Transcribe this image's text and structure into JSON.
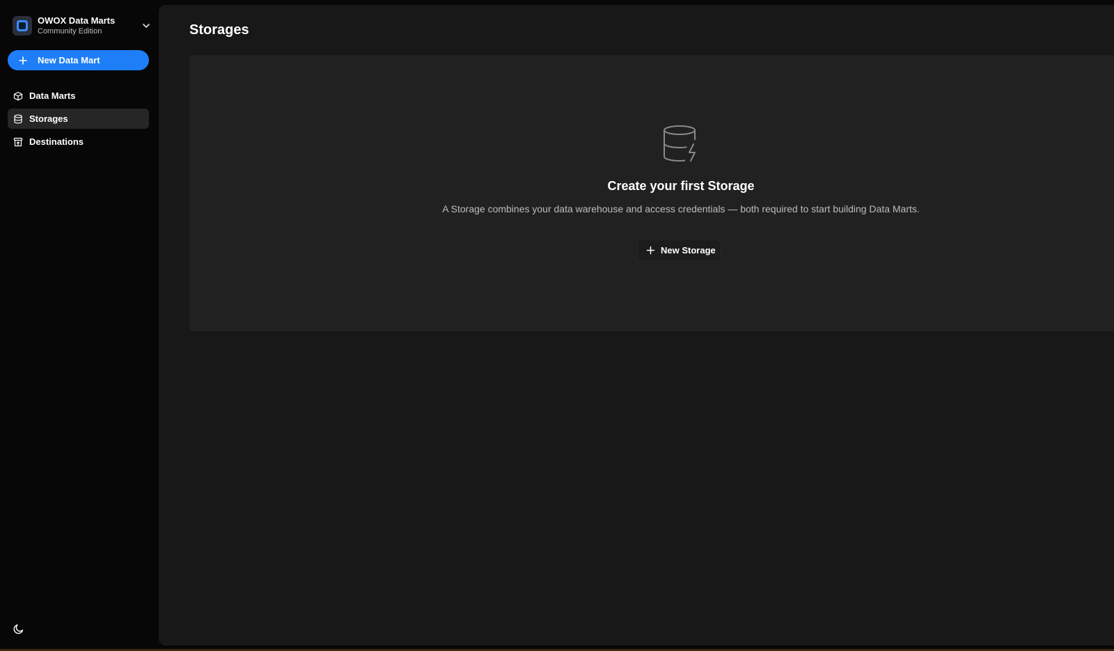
{
  "brand": {
    "title": "OWOX Data Marts",
    "subtitle": "Community Edition"
  },
  "sidebar": {
    "new_button_label": "New Data Mart",
    "items": [
      {
        "label": "Data Marts",
        "icon": "cube-icon",
        "active": false
      },
      {
        "label": "Storages",
        "icon": "database-icon",
        "active": true
      },
      {
        "label": "Destinations",
        "icon": "destination-icon",
        "active": false
      }
    ],
    "theme_toggle_icon": "moon-icon"
  },
  "main": {
    "page_title": "Storages",
    "empty_state": {
      "icon": "database-bolt-icon",
      "heading": "Create your first Storage",
      "description": "A Storage combines your data warehouse and access credentials — both required to start building Data Marts.",
      "button_label": "New Storage"
    }
  },
  "colors": {
    "accent": "#1e7ef7",
    "sidebar_bg": "#070707",
    "main_bg": "#181818",
    "card_bg": "#212121"
  }
}
